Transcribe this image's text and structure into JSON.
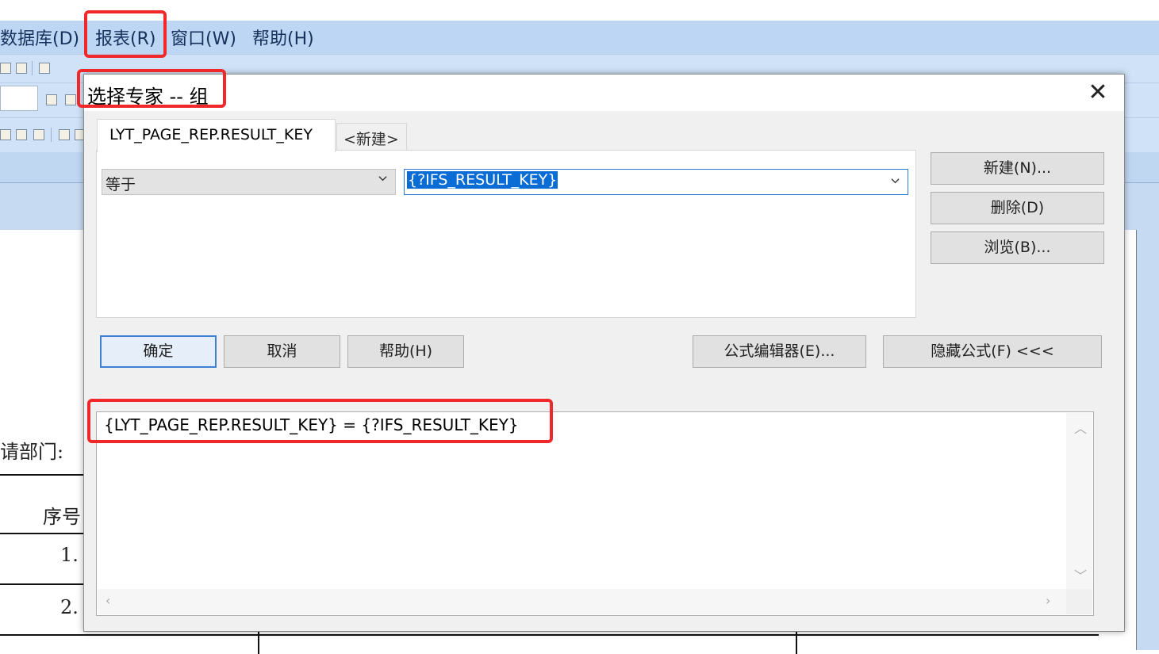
{
  "menubar": {
    "items": [
      {
        "label": "数据库(D)"
      },
      {
        "label": "报表(R)"
      },
      {
        "label": "窗口(W)"
      },
      {
        "label": "帮助(H)"
      }
    ]
  },
  "document": {
    "dept_label": "请部门:",
    "col_header": "序号",
    "rows": [
      "1.",
      "2."
    ]
  },
  "dialog": {
    "title": "选择专家 -- 组",
    "tabs": [
      {
        "label": "LYT_PAGE_REP.RESULT_KEY"
      },
      {
        "label": "<新建>"
      }
    ],
    "operator_value": "等于",
    "compare_value": "{?IFS_RESULT_KEY}",
    "side_buttons": {
      "new": "新建(N)...",
      "delete": "删除(D)",
      "browse": "浏览(B)..."
    },
    "bottom_buttons": {
      "ok": "确定",
      "cancel": "取消",
      "help": "帮助(H)",
      "formula_editor": "公式编辑器(E)...",
      "hide_formula": "隐藏公式(F) <<<"
    },
    "formula_text": "{LYT_PAGE_REP.RESULT_KEY} = {?IFS_RESULT_KEY}"
  },
  "colors": {
    "highlight_box": "#f0282a",
    "menubar_bg": "#bcd6f4",
    "selection": "#0a6dd6"
  }
}
